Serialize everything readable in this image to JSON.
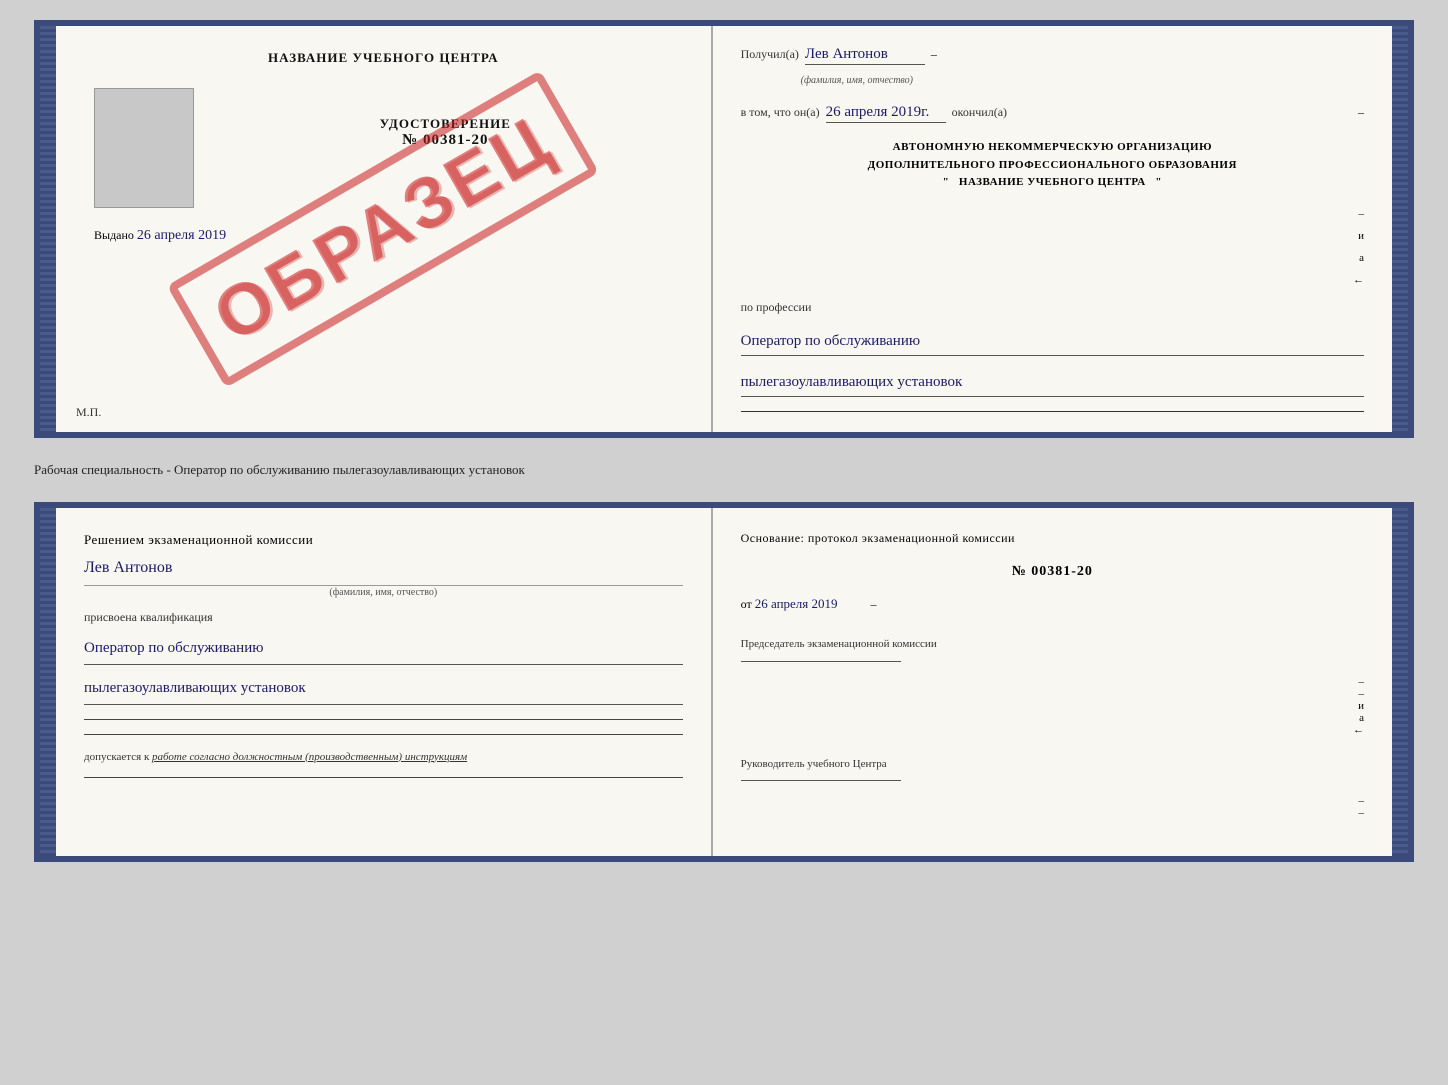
{
  "cert1": {
    "left": {
      "title": "НАЗВАНИЕ УЧЕБНОГО ЦЕНТРА",
      "cert_type": "УДОСТОВЕРЕНИЕ",
      "cert_number": "№ 00381-20",
      "issued_label": "Выдано",
      "issued_date": "26 апреля 2019",
      "mp_label": "М.П.",
      "obrazec": "ОБРАЗЕЦ"
    },
    "right": {
      "received_label": "Получил(а)",
      "received_name": "Лев Антонов",
      "name_subtitle": "(фамилия, имя, отчество)",
      "completed_prefix": "в том, что он(а)",
      "completed_date": "26 апреля 2019г.",
      "completed_suffix": "окончил(а)",
      "org_block": "АВТОНОМНУЮ НЕКОММЕРЧЕСКУЮ ОРГАНИЗАЦИЮ\nДОПОЛНИТЕЛЬНОГО ПРОФЕССИОНАЛЬНОГО ОБРАЗОВАНИЯ\n\" НАЗВАНИЕ УЧЕБНОГО ЦЕНТРА \"",
      "profession_label": "по профессии",
      "profession_line1": "Оператор по обслуживанию",
      "profession_line2": "пылегазоулавливающих установок"
    }
  },
  "separator": {
    "text": "Рабочая специальность - Оператор по обслуживанию пылегазоулавливающих установок"
  },
  "cert2": {
    "left": {
      "decision_label": "Решением экзаменационной комиссии",
      "person_name": "Лев Антонов",
      "name_subtitle": "(фамилия, имя, отчество)",
      "assigned_label": "присвоена квалификация",
      "qualification_line1": "Оператор по обслуживанию",
      "qualification_line2": "пылегазоулавливающих установок",
      "allowed_label": "допускается к",
      "allowed_text": "работе согласно должностным (производственным) инструкциям"
    },
    "right": {
      "basis_label": "Основание: протокол экзаменационной комиссии",
      "protocol_number": "№ 00381-20",
      "date_prefix": "от",
      "protocol_date": "26 апреля 2019",
      "chairman_label": "Председатель экзаменационной комиссии",
      "director_label": "Руководитель учебного Центра"
    }
  }
}
